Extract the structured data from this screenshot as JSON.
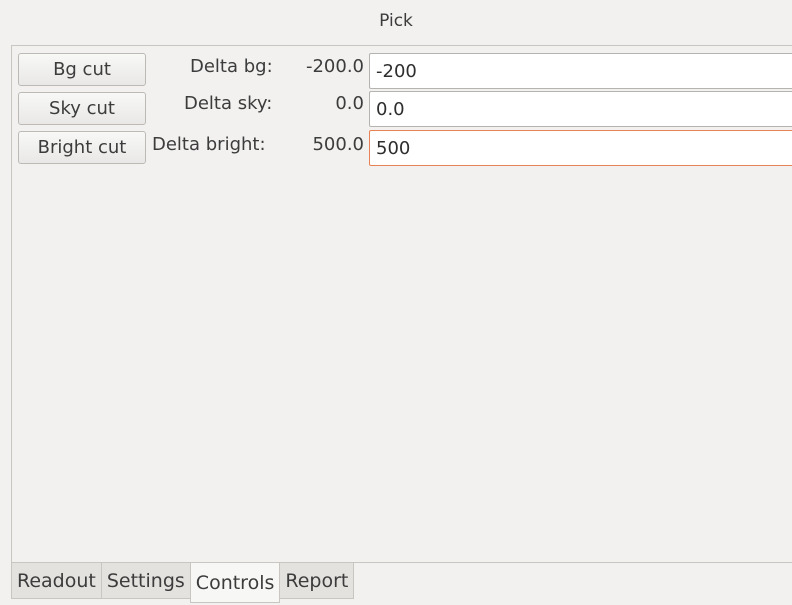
{
  "window": {
    "title": "Pick"
  },
  "controls": {
    "rows": [
      {
        "button_label": "Bg cut",
        "delta_label": "Delta bg:",
        "delta_value": "-200.0",
        "entry_value": "-200"
      },
      {
        "button_label": "Sky cut",
        "delta_label": "Delta sky:",
        "delta_value": "0.0",
        "entry_value": "0.0"
      },
      {
        "button_label": "Bright cut",
        "delta_label": "Delta bright:",
        "delta_value": "500.0",
        "entry_value": "500"
      }
    ]
  },
  "tabs": {
    "items": [
      {
        "label": "Readout"
      },
      {
        "label": "Settings"
      },
      {
        "label": "Controls",
        "active": true
      },
      {
        "label": "Report"
      }
    ]
  },
  "colors": {
    "focus_border": "#e98157",
    "background": "#f2f1f0"
  }
}
